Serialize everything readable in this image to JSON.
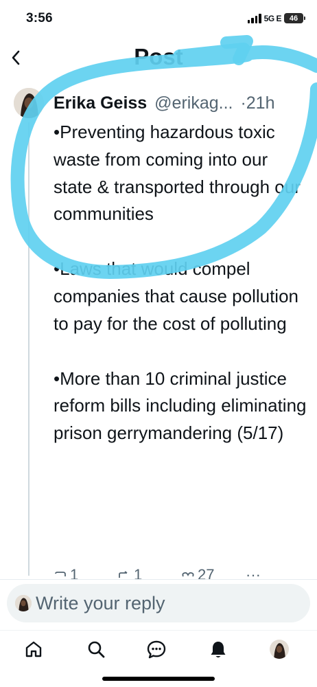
{
  "status_bar": {
    "time": "3:56",
    "network": "5G E",
    "battery": "46"
  },
  "header": {
    "title": "Post",
    "back_glyph": "‹"
  },
  "tweet": {
    "author_name": "Erika Geiss",
    "author_handle": "@erikag...",
    "time_ago": "·21h",
    "paragraphs": [
      "•Preventing hazardous toxic waste from coming into our state & transported through our communities",
      "•Laws that would compel companies that cause pollution to pay for the cost of polluting",
      "•More than 10 criminal justice reform bills including eliminating prison gerrymandering (5/17)"
    ],
    "actions": {
      "reply_count": "1",
      "retweet_count": "1",
      "like_count": "27",
      "more_glyph": "···"
    }
  },
  "reply": {
    "placeholder": "Write your reply"
  },
  "nav": {
    "items": [
      "home-icon",
      "search-icon",
      "messages-icon",
      "notifications-icon",
      "profile-avatar"
    ]
  },
  "colors": {
    "annotation": "#5fd0f0",
    "secondary_text": "#536471",
    "thread_line": "#cfd9de"
  }
}
